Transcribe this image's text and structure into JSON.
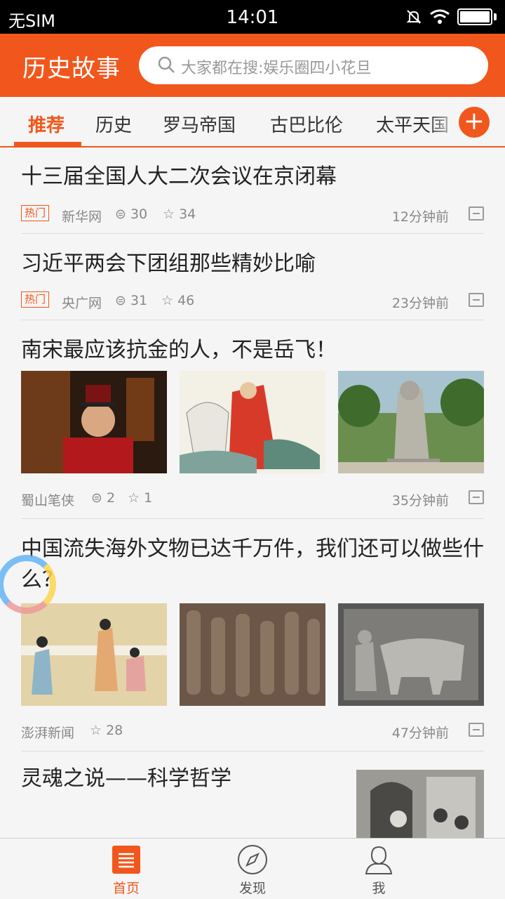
{
  "status_bar": {
    "carrier": "无SIM",
    "time": "14:01"
  },
  "app": {
    "title": "历史故事",
    "search_placeholder": "大家都在搜:娱乐圈四小花旦"
  },
  "tabs": [
    {
      "label": "推荐",
      "active": true
    },
    {
      "label": "历史",
      "active": false
    },
    {
      "label": "罗马帝国",
      "active": false
    },
    {
      "label": "古巴比伦",
      "active": false
    },
    {
      "label": "太平天国",
      "active": false
    }
  ],
  "feed": [
    {
      "title": "十三届全国人大二次会议在京闭幕",
      "tag": "热门",
      "source": "新华网",
      "comments": "30",
      "stars": "34",
      "time": "12分钟前"
    },
    {
      "title": "习近平两会下团组那些精妙比喻",
      "tag": "热门",
      "source": "央广网",
      "comments": "31",
      "stars": "46",
      "time": "23分钟前"
    },
    {
      "title": "南宋最应该抗金的人，不是岳飞！",
      "source": "蜀山笔侠",
      "comments": "2",
      "stars": "1",
      "time": "35分钟前"
    },
    {
      "title": "中国流失海外文物已达千万件，我们还可以做些什么？",
      "source": "澎湃新闻",
      "stars": "28",
      "time": "47分钟前"
    },
    {
      "title": "灵魂之说——科学哲学"
    }
  ],
  "bottom_nav": [
    {
      "label": "首页",
      "icon": "home-list-icon",
      "active": true
    },
    {
      "label": "发现",
      "icon": "compass-icon",
      "active": false
    },
    {
      "label": "我",
      "icon": "person-icon",
      "active": false
    }
  ],
  "colors": {
    "accent": "#f1571c"
  }
}
